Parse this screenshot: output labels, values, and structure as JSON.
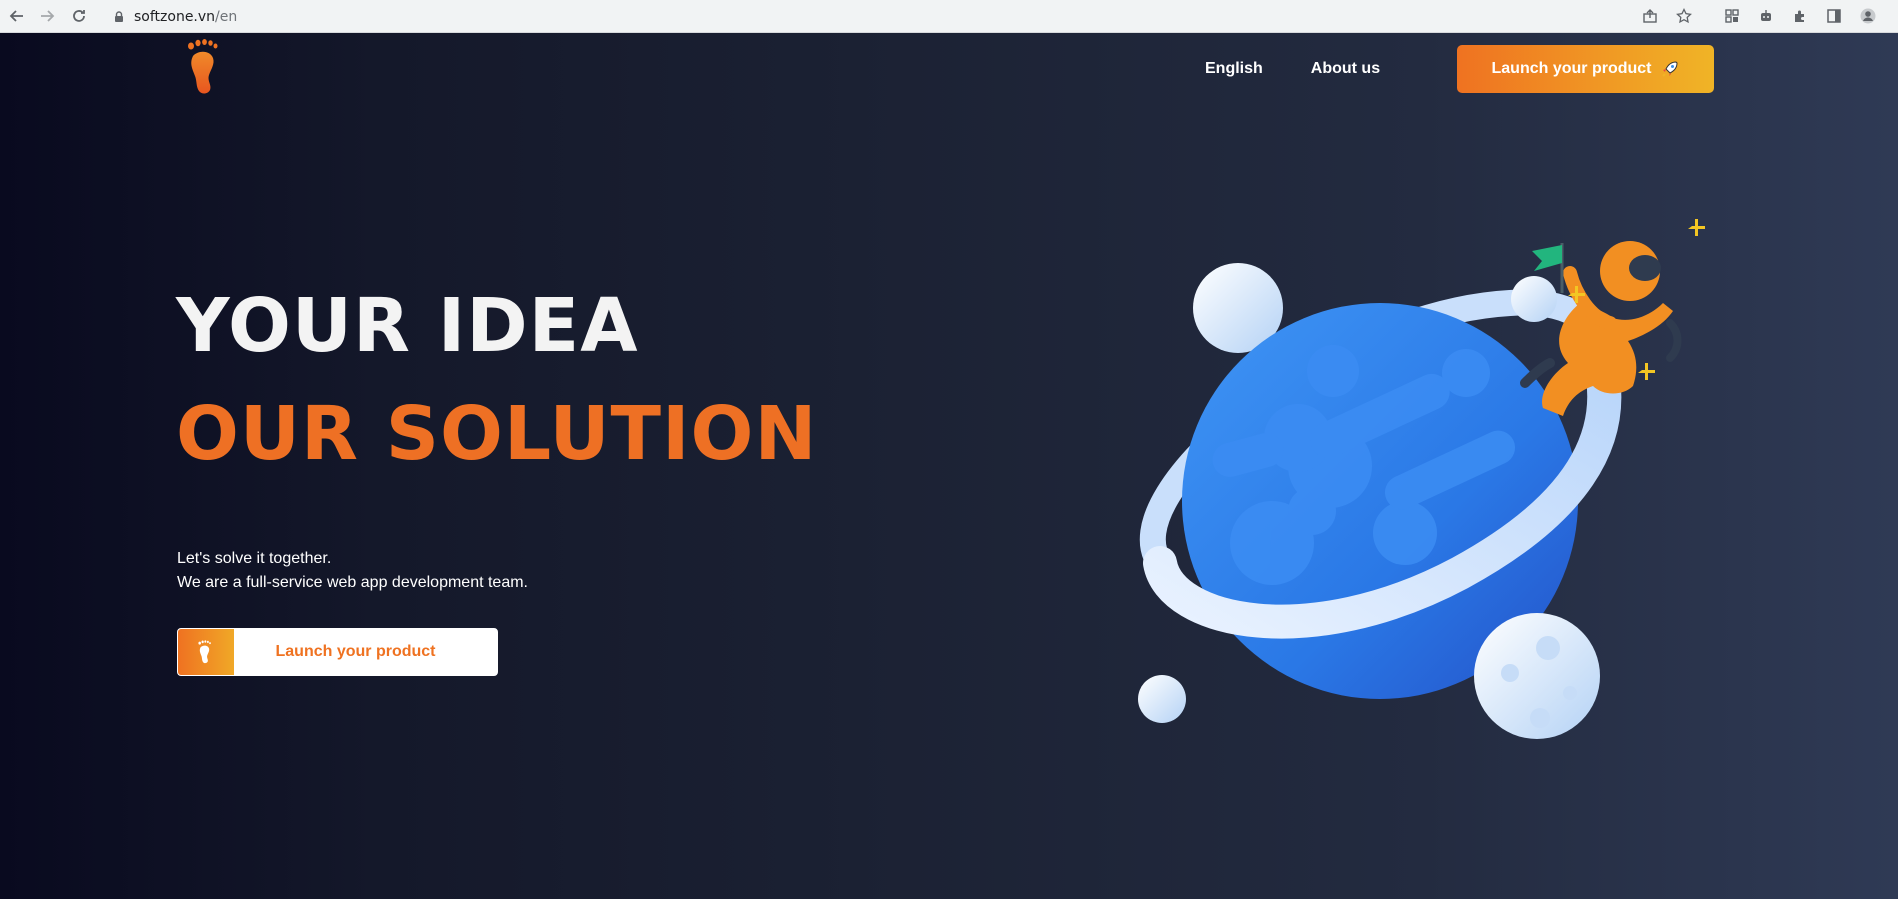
{
  "browser": {
    "url_host": "softzone.vn",
    "url_path": "/en",
    "icons": [
      "back-icon",
      "forward-icon",
      "reload-icon",
      "lock-icon",
      "share-icon",
      "star-icon",
      "qr-icon",
      "robot-icon",
      "extensions-icon",
      "sidepanel-icon",
      "profile-icon"
    ]
  },
  "nav": {
    "language": "English",
    "about": "About us",
    "cta": "Launch your product"
  },
  "hero": {
    "headline_1": "YOUR IDEA",
    "headline_2": "OUR SOLUTION",
    "tagline_1": "Let's solve it together.",
    "tagline_2": "We are a full-service web app development team.",
    "cta": "Launch your product"
  },
  "colors": {
    "accent": "#ee7024",
    "accent_end": "#f0b426",
    "planet": "#2f7de8",
    "background": "#14182a"
  }
}
